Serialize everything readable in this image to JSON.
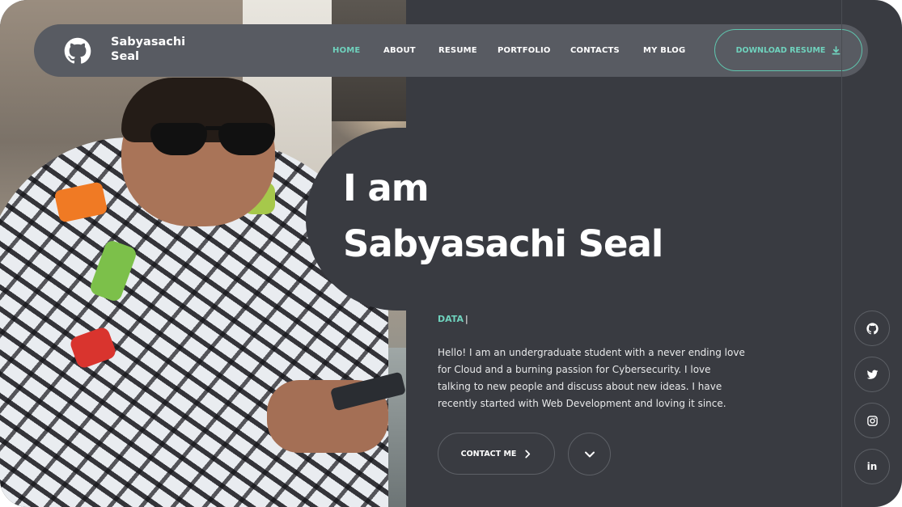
{
  "brand": {
    "name_line1": "Sabyasachi",
    "name_line2": "Seal",
    "icon": "github-icon"
  },
  "nav": {
    "items": [
      {
        "label": "HOME",
        "active": true
      },
      {
        "label": "ABOUT",
        "active": false
      },
      {
        "label": "RESUME",
        "active": false
      },
      {
        "label": "PORTFOLIO",
        "active": false
      },
      {
        "label": "CONTACTS",
        "active": false
      },
      {
        "label": "MY BLOG",
        "active": false
      }
    ],
    "download": {
      "label": "DOWNLOAD RESUME",
      "icon": "download-icon"
    }
  },
  "hero": {
    "line1": "I am",
    "line2": "Sabyasachi Seal",
    "typed_word": "DATA",
    "caret": "|",
    "bio": "Hello! I am an undergraduate student with a never ending love for Cloud and a burning passion for Cybersecurity. I love talking to new people and discuss about new ideas. I have recently started with Web Development and loving it since.",
    "contact_label": "CONTACT ME",
    "contact_icon": "chevron-right-icon",
    "scroll_icon": "chevron-down-icon"
  },
  "social": [
    {
      "name": "github-icon"
    },
    {
      "name": "twitter-icon"
    },
    {
      "name": "instagram-icon"
    },
    {
      "name": "linkedin-icon",
      "text": "in"
    }
  ],
  "colors": {
    "background": "#393b41",
    "navbar": "#585b62",
    "accent": "#6fd2bd",
    "text": "#ffffff"
  }
}
